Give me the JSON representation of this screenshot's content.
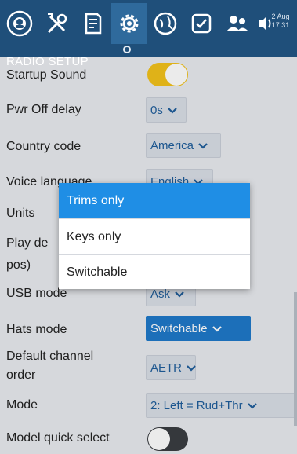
{
  "header": {
    "clock_date": "2 Aug",
    "clock_time": "17:31",
    "section_title": "RADIO SETUP"
  },
  "tabs": [
    {
      "icon": "home-icon"
    },
    {
      "icon": "tools-icon"
    },
    {
      "icon": "sd-card-icon"
    },
    {
      "icon": "gear-icon",
      "active": true
    },
    {
      "icon": "globe-icon"
    },
    {
      "icon": "checklist-icon"
    },
    {
      "icon": "users-icon"
    },
    {
      "icon": "speaker-icon"
    }
  ],
  "settings": {
    "startup_sound": {
      "label": "Startup Sound",
      "on": true
    },
    "pwr_off_delay": {
      "label": "Pwr Off delay",
      "value": "0s"
    },
    "country_code": {
      "label": "Country code",
      "value": "America"
    },
    "voice_language": {
      "label": "Voice language",
      "value": "English"
    },
    "units": {
      "label": "Units"
    },
    "play_delay": {
      "label_line1": "Play de",
      "label_line2": "pos)"
    },
    "usb_mode": {
      "label": "USB mode",
      "value": "Ask"
    },
    "hats_mode": {
      "label": "Hats mode",
      "value": "Switchable"
    },
    "default_channel_order": {
      "label_line1": "Default channel",
      "label_line2": "order",
      "value": "AETR"
    },
    "mode": {
      "label": "Mode",
      "value": "2: Left = Rud+Thr"
    },
    "model_quick_select": {
      "label": "Model quick select",
      "on": false
    }
  },
  "popup": {
    "options": [
      "Trims only",
      "Keys only",
      "Switchable"
    ],
    "selected_index": 0
  },
  "colors": {
    "header": "#1f4f7a",
    "accent": "#1f8ee5",
    "toggle_on": "#f2c21b",
    "toggle_off": "#3a3d42"
  }
}
